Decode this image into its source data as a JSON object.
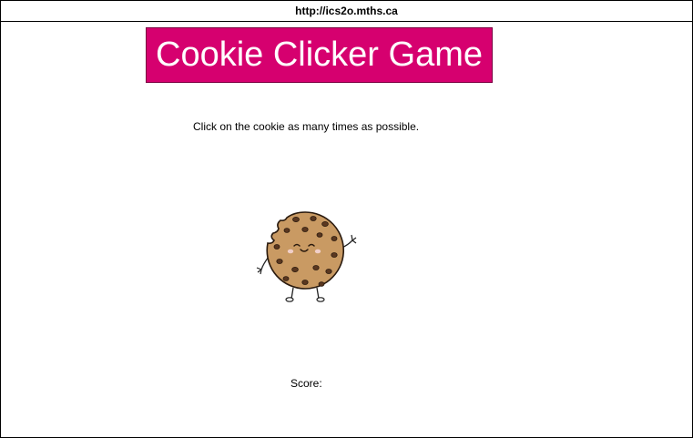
{
  "browser": {
    "url": "http://ics2o.mths.ca"
  },
  "page": {
    "title": "Cookie Clicker Game",
    "title_bg_color": "#d6006f",
    "instructions": "Click on the cookie as many times as possible.",
    "cookie_icon": "cookie-character-icon",
    "score_label": "Score:",
    "score_value": ""
  }
}
